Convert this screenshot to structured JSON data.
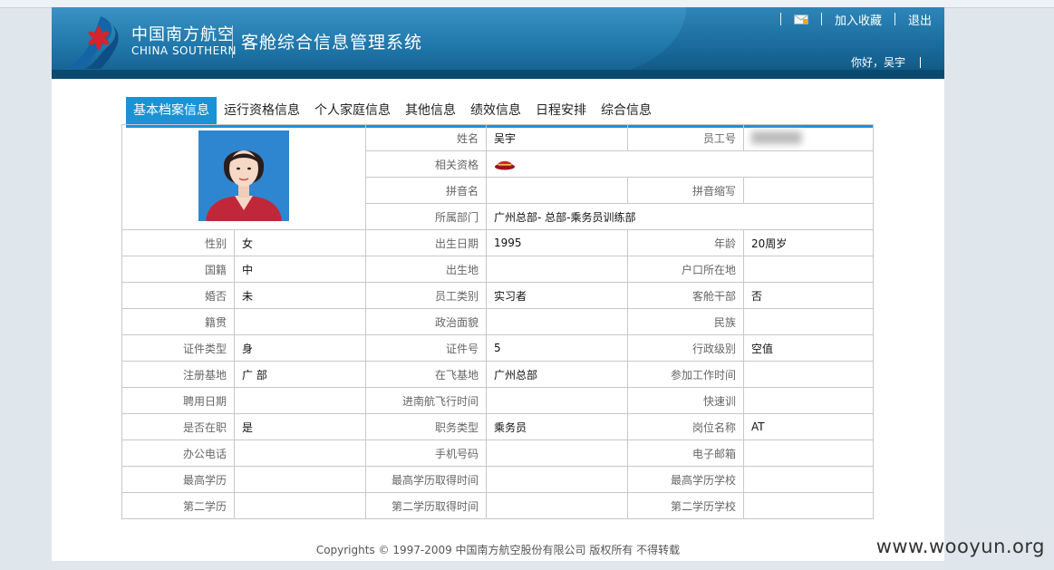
{
  "header": {
    "logo_cn": "中国南方航空",
    "logo_en": "CHINA SOUTHERN",
    "system_title": "客舱综合信息管理系统",
    "add_favorite": "加入收藏",
    "logout": "退出",
    "greeting": "你好，吴宇"
  },
  "tabs": [
    {
      "label": "基本档案信息",
      "active": true
    },
    {
      "label": "运行资格信息",
      "active": false
    },
    {
      "label": "个人家庭信息",
      "active": false
    },
    {
      "label": "其他信息",
      "active": false
    },
    {
      "label": "绩效信息",
      "active": false
    },
    {
      "label": "日程安排",
      "active": false
    },
    {
      "label": "综合信息",
      "active": false
    }
  ],
  "profile": {
    "name_label": "姓名",
    "name_value": "吴宇",
    "empno_label": "员工号",
    "empno_value": "",
    "qual_label": "相关资格",
    "pinyin_label": "拼音名",
    "pinyin_value": "",
    "pinyin_abbr_label": "拼音缩写",
    "pinyin_abbr_value": "",
    "dept_label": "所属部门",
    "dept_value": "广州总部-  总部-乘务员训练部",
    "rows": [
      {
        "l1": "性别",
        "v1": "女",
        "l2": "出生日期",
        "v2": "1995",
        "l3": "年龄",
        "v3": "20周岁"
      },
      {
        "l1": "国籍",
        "v1": "中",
        "l2": "出生地",
        "v2": "",
        "l3": "户口所在地",
        "v3": ""
      },
      {
        "l1": "婚否",
        "v1": "未",
        "l2": "员工类别",
        "v2": "实习者",
        "l3": "客舱干部",
        "v3": "否"
      },
      {
        "l1": "籍贯",
        "v1": "",
        "l2": "政治面貌",
        "v2": "",
        "l3": "民族",
        "v3": ""
      },
      {
        "l1": "证件类型",
        "v1": "身   ",
        "l2": "证件号",
        "v2": "5",
        "l3": "行政级别",
        "v3": "空值"
      },
      {
        "l1": "注册基地",
        "v1": "广   部",
        "l2": "在飞基地",
        "v2": "广州总部",
        "l3": "参加工作时间",
        "v3": ""
      },
      {
        "l1": "聘用日期",
        "v1": "",
        "l2": "进南航飞行时间",
        "v2": "",
        "l3": "快速训",
        "v3": ""
      },
      {
        "l1": "是否在职",
        "v1": "是",
        "l2": "职务类型",
        "v2": "乘务员",
        "l3": "岗位名称",
        "v3": "AT"
      },
      {
        "l1": "办公电话",
        "v1": "",
        "l2": "手机号码",
        "v2": "",
        "l3": "电子邮箱",
        "v3": ""
      },
      {
        "l1": "最高学历",
        "v1": "",
        "l2": "最高学历取得时间",
        "v2": "",
        "l3": "最高学历学校",
        "v3": ""
      },
      {
        "l1": "第二学历",
        "v1": "",
        "l2": "第二学历取得时间",
        "v2": "",
        "l3": "第二学历学校",
        "v3": ""
      }
    ]
  },
  "footer": "Copyrights © 1997-2009 中国南方航空股份有限公司 版权所有 不得转载",
  "watermark": "www.wooyun.org",
  "colors": {
    "header_blue": "#1b6d9f",
    "tab_active": "#1a92d4",
    "logo_red": "#d6232c"
  }
}
